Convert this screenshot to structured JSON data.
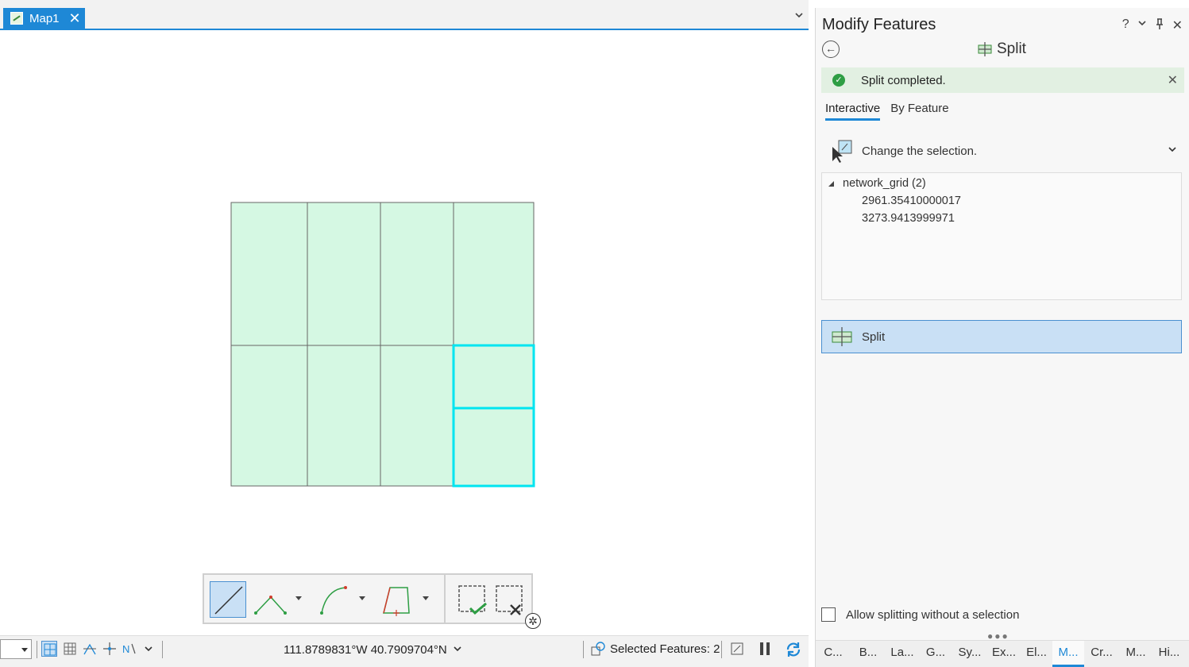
{
  "map_tab": {
    "label": "Map1"
  },
  "status_bar": {
    "coordinates": "111.8789831°W 40.7909704°N",
    "selected_features": "Selected Features: 2"
  },
  "pane": {
    "title": "Modify Features",
    "tool_title": "Split",
    "message": "Split completed.",
    "tabs": [
      {
        "label": "Interactive",
        "active": true
      },
      {
        "label": "By Feature",
        "active": false
      }
    ],
    "change_selection": "Change the selection.",
    "selection": {
      "layer_label": "network_grid (2)",
      "features": [
        "2961.35410000017",
        "3273.9413999971"
      ]
    },
    "split_button": "Split",
    "allow_label": "Allow splitting without a selection",
    "bottom_tabs": [
      "C...",
      "B...",
      "La...",
      "G...",
      "Sy...",
      "Ex...",
      "El...",
      "M...",
      "Cr...",
      "M...",
      "Hi..."
    ],
    "active_bottom_tab": 7
  },
  "colors": {
    "accent": "#1e88d6",
    "polygon_fill": "#d5f8e3",
    "selection_outline": "#00e5f0",
    "success": "#2e9e44"
  },
  "icons": [
    "close-icon",
    "chevron-down-icon",
    "help-icon",
    "pin-icon",
    "back-icon",
    "split-icon",
    "check-circle-icon",
    "cursor-select-icon",
    "gear-icon"
  ]
}
